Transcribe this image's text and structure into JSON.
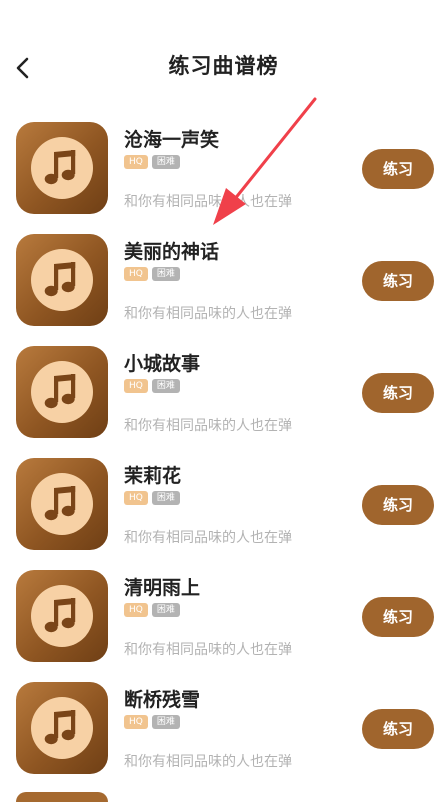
{
  "header": {
    "title": "练习曲谱榜"
  },
  "songs": [
    {
      "name": "沧海一声笑",
      "hq": "HQ",
      "level": "困难",
      "subtitle": "和你有相同品味的人也在弹",
      "action": "练习"
    },
    {
      "name": "美丽的神话",
      "hq": "HQ",
      "level": "困难",
      "subtitle": "和你有相同品味的人也在弹",
      "action": "练习"
    },
    {
      "name": "小城故事",
      "hq": "HQ",
      "level": "困难",
      "subtitle": "和你有相同品味的人也在弹",
      "action": "练习"
    },
    {
      "name": "茉莉花",
      "hq": "HQ",
      "level": "困难",
      "subtitle": "和你有相同品味的人也在弹",
      "action": "练习"
    },
    {
      "name": "清明雨上",
      "hq": "HQ",
      "level": "困难",
      "subtitle": "和你有相同品味的人也在弹",
      "action": "练习"
    },
    {
      "name": "断桥残雪",
      "hq": "HQ",
      "level": "困难",
      "subtitle": "和你有相同品味的人也在弹",
      "action": "练习"
    }
  ],
  "icons": {
    "back": "chevron-left-icon",
    "cover": "music-note-icon",
    "annotation": "red-arrow-annotation"
  },
  "colors": {
    "cover_brown": "#8f5622",
    "disc": "#f7d1a5",
    "button": "#a0652d",
    "hq_tag": "#f1c48f",
    "level_tag": "#b3b3b3",
    "arrow": "#f0404a"
  }
}
